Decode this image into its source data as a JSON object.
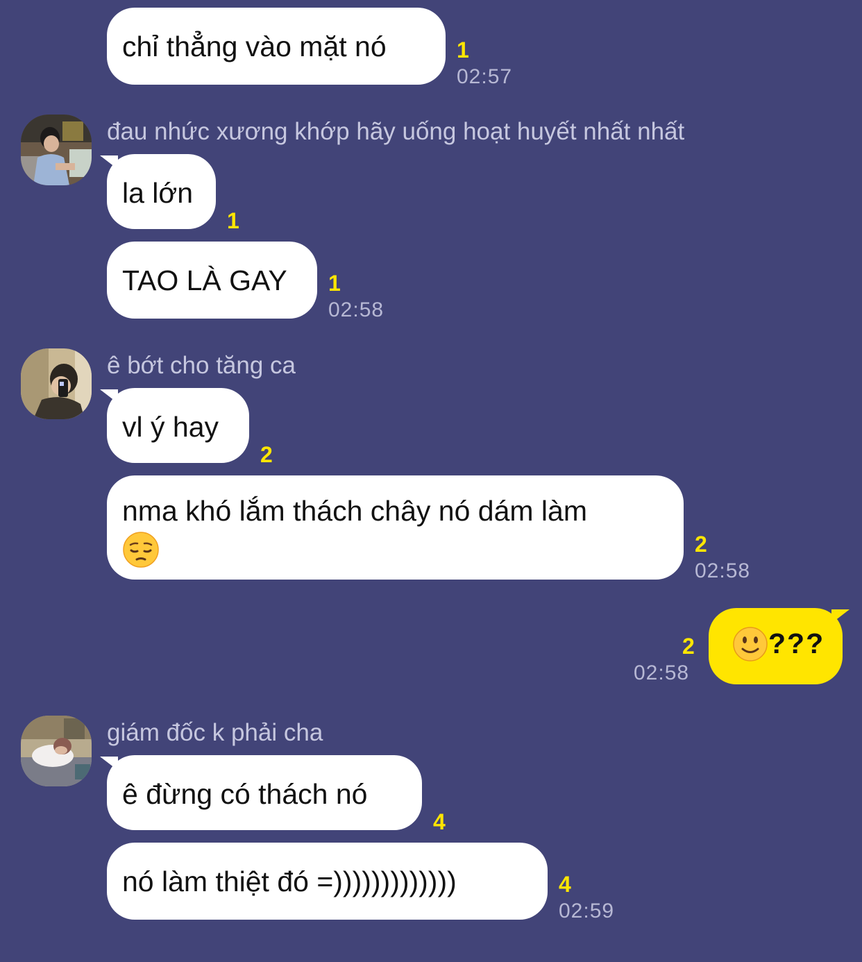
{
  "colors": {
    "background": "#424478",
    "bubble_other": "#ffffff",
    "bubble_own": "#ffe500",
    "unread_count": "#ffe600",
    "timestamp": "#b7b8d4",
    "sender_name": "#c6c7df"
  },
  "messages": [
    {
      "text": "chỉ thẳng vào mặt nó",
      "unread": "1",
      "time": "02:57"
    },
    {
      "sender": "đau nhức xương khớp hãy uống hoạt huyết nhất nhất",
      "avatar_icon": "profile-photo-man-cafe"
    },
    {
      "text": "la lớn",
      "unread": "1"
    },
    {
      "text": "TAO LÀ GAY",
      "unread": "1",
      "time": "02:58"
    },
    {
      "sender": "ê bớt cho tăng ca",
      "avatar_icon": "profile-photo-mirror-selfie"
    },
    {
      "text": "vl ý hay",
      "unread": "2"
    },
    {
      "text": "nma khó lắm thách chây nó dám làm",
      "emoji_icon": "pensive-face-emoji",
      "unread": "2",
      "time": "02:58"
    },
    {
      "text": "???",
      "emoji_icon": "slightly-smiling-face-emoji",
      "unread": "2",
      "time": "02:58",
      "own": true
    },
    {
      "sender": "giám đốc k phải cha",
      "avatar_icon": "profile-photo-sleeping"
    },
    {
      "text": "ê đừng có thách nó",
      "unread": "4"
    },
    {
      "text": "nó làm thiệt đó =)))))))))))))",
      "unread": "4",
      "time": "02:59"
    }
  ]
}
